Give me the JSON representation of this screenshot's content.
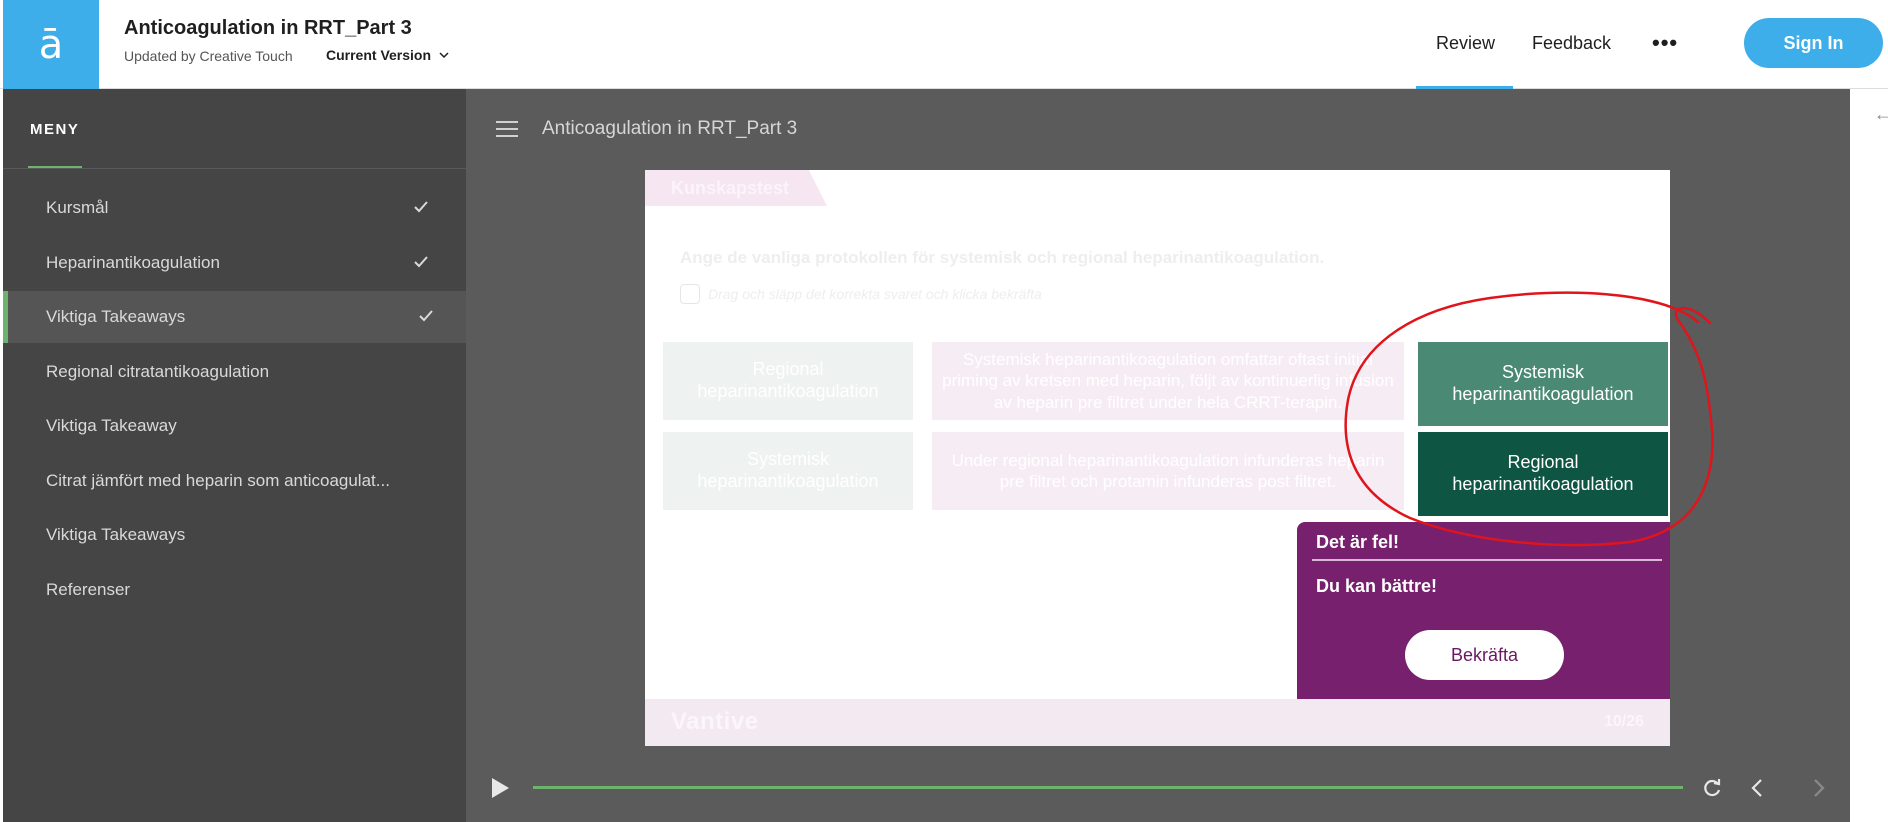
{
  "header": {
    "logo_glyph": "ā",
    "course_title": "Anticoagulation in RRT_Part 3",
    "updated_by": "Updated by Creative Touch",
    "version_label": "Current Version",
    "nav": {
      "review": "Review",
      "feedback": "Feedback",
      "more": "•••"
    },
    "sign_in": "Sign In",
    "accent_color": "#3daee9"
  },
  "sidebar": {
    "heading": "MENY",
    "items": [
      {
        "label": "Kursmål",
        "completed": true,
        "active": false
      },
      {
        "label": "Heparinantikoagulation",
        "completed": true,
        "active": false
      },
      {
        "label": "Viktiga Takeaways",
        "completed": true,
        "active": true
      },
      {
        "label": "Regional citratantikoagulation",
        "completed": false,
        "active": false
      },
      {
        "label": "Viktiga Takeaway",
        "completed": false,
        "active": false
      },
      {
        "label": "Citrat jämfört med heparin som anticoagulat...",
        "completed": false,
        "active": false
      },
      {
        "label": "Viktiga Takeaways",
        "completed": false,
        "active": false
      },
      {
        "label": "Referenser",
        "completed": false,
        "active": false
      }
    ]
  },
  "main": {
    "title": "Anticoagulation in RRT_Part 3"
  },
  "slide": {
    "tab_label": "Kunskapstest",
    "question": "Ange de vanliga protokollen för systemisk och regional heparinantikoagulation.",
    "hint": "Drag och släpp det korrekta svaret och klicka bekräfta",
    "drop_targets": [
      {
        "label": "Regional heparinantikoagulation",
        "description": "Systemisk heparinantikoagulation omfattar oftast initial priming av kretsen med heparin, följt av kontinuerlig infusion av heparin pre filtret under hela CRRT-terapin."
      },
      {
        "label": "Systemisk heparinantikoagulation",
        "description": "Under regional heparinantikoagulation infunderas heparin pre filtret och protamin infunderas post filtret."
      }
    ],
    "answers": [
      {
        "label": "Systemisk heparinantikoagulation",
        "color": "#4a8a74"
      },
      {
        "label": "Regional heparinantikoagulation",
        "color": "#0f5544"
      }
    ],
    "feedback": {
      "title": "Det är fel!",
      "message": "Du kan bättre!",
      "button": "Bekräfta",
      "color": "#76206e"
    },
    "brand": "Vantive",
    "page": "10/26"
  },
  "player": {
    "progress": 1.0,
    "progress_color": "#6db36d"
  }
}
